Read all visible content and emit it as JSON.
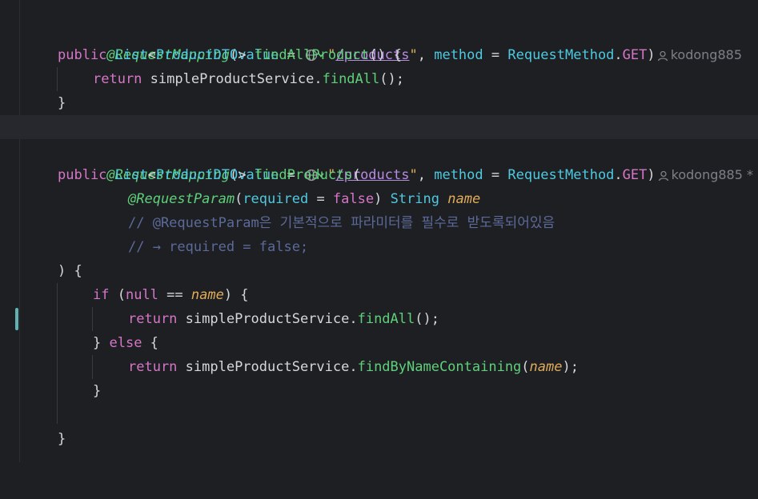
{
  "editor": {
    "author_1": "kodong885",
    "author_2": "kodong885 *",
    "lines": {
      "l1": {
        "a1": "@RequestMapping",
        "a2": "(",
        "a3": "value",
        "a4": " = ",
        "a5": "\"",
        "a6": "/products",
        "a7": "\"",
        "a8": ", ",
        "a9": "method",
        "a10": " = ",
        "a11": "RequestMethod",
        "a12": ".",
        "a13": "GET",
        "a14": ")"
      },
      "l2": {
        "a1": "public ",
        "a2": "List",
        "a3": "<",
        "a4": "ProductDTO",
        "a5": "> ",
        "a6": "findAllProduct",
        "a7": "() {"
      },
      "l3": {
        "a1": "return ",
        "a2": "simpleProductService.",
        "a3": "findAll",
        "a4": "();"
      },
      "l4": {
        "a1": "}"
      },
      "l6": {
        "a1": "@RequestMapping",
        "a2": "(",
        "a3": "value",
        "a4": " = ",
        "a5": "\"",
        "a6": "/products",
        "a7": "\"",
        "a8": ", ",
        "a9": "method",
        "a10": " = ",
        "a11": "RequestMethod",
        "a12": ".",
        "a13": "GET",
        "a14": ")"
      },
      "l7": {
        "a1": "public ",
        "a2": "List",
        "a3": "<",
        "a4": "ProductDTO",
        "a5": "> ",
        "a6": "findProducts",
        "a7": "("
      },
      "l8": {
        "a1": "@RequestParam",
        "a2": "(",
        "a3": "required",
        "a4": " = ",
        "a5": "false",
        "a6": ") ",
        "a7": "String",
        "a8": " ",
        "a9": "name"
      },
      "l9": {
        "a1": "// @RequestParam은 기본적으로 파라미터를 필수로 받도록되어있음"
      },
      "l10": {
        "a1": "// → required = false;"
      },
      "l11": {
        "a1": ") {"
      },
      "l12": {
        "a1": "if",
        "a2": " (",
        "a3": "null",
        "a4": " == ",
        "a5": "name",
        "a6": ") {"
      },
      "l13": {
        "a1": "return ",
        "a2": "simpleProductService.",
        "a3": "findAll",
        "a4": "();"
      },
      "l14": {
        "a1": "} ",
        "a2": "else",
        "a3": " {"
      },
      "l15": {
        "a1": "return ",
        "a2": "simpleProductService.",
        "a3": "findByNameContaining",
        "a4": "(",
        "a5": "name",
        "a6": ");"
      },
      "l16": {
        "a1": "}"
      },
      "l18": {
        "a1": "}"
      }
    },
    "colors": {
      "background": "#1e1f22",
      "current_line": "#26282e",
      "gutter_marker": "#5fb3b3"
    }
  }
}
